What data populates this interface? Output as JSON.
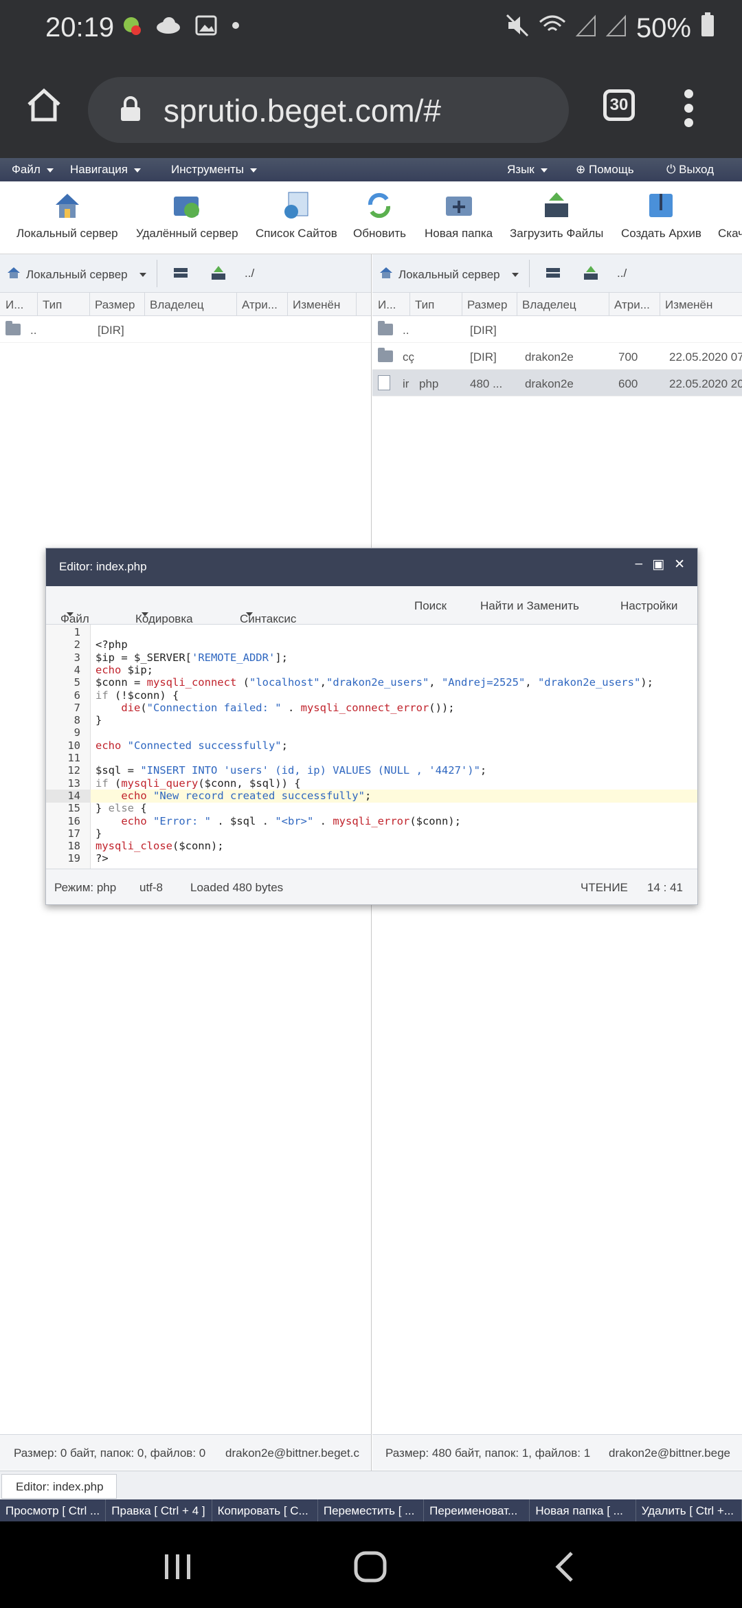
{
  "status_bar": {
    "time": "20:19",
    "battery": "50%"
  },
  "browser": {
    "url": "sprutio.beget.com/#",
    "tab_count": "30"
  },
  "menubar": {
    "left": [
      "Файл",
      "Навигация",
      "Инструменты"
    ],
    "language": "Язык",
    "help": "Помощь",
    "exit": "Выход"
  },
  "toolbar": {
    "items": [
      "Локальный сервер",
      "Удалённый сервер",
      "Список Сайтов",
      "Обновить",
      "Новая папка",
      "Загрузить Файлы",
      "Создать Архив",
      "Скач"
    ]
  },
  "left_panel": {
    "server": "Локальный сервер",
    "path": "../",
    "columns": [
      "И...",
      "Тип",
      "Размер",
      "Владелец",
      "Атри...",
      "Изменён"
    ],
    "rows": [
      {
        "name": "..",
        "type": "",
        "size": "[DIR]",
        "owner": "",
        "attr": "",
        "modified": ""
      }
    ],
    "status": "Размер: 0 байт, папок: 0, файлов: 0",
    "host": "drakon2e@bittner.beget.c"
  },
  "right_panel": {
    "server": "Локальный сервер",
    "path": "../",
    "columns": [
      "И...",
      "Тип",
      "Размер",
      "Владелец",
      "Атри...",
      "Изменён"
    ],
    "rows": [
      {
        "name": "..",
        "type": "",
        "size": "[DIR]",
        "owner": "",
        "attr": "",
        "modified": ""
      },
      {
        "name": "cç",
        "type": "",
        "size": "[DIR]",
        "owner": "drakon2e",
        "attr": "700",
        "modified": "22.05.2020 07"
      },
      {
        "name": "ir",
        "type": "php",
        "size": "480 ...",
        "owner": "drakon2e",
        "attr": "600",
        "modified": "22.05.2020 20"
      }
    ],
    "status": "Размер: 480 байт, папок: 1, файлов: 1",
    "host": "drakon2e@bittner.bege"
  },
  "editor": {
    "title": "Editor: index.php",
    "menu": [
      "Файл",
      "Кодировка",
      "Синтаксис"
    ],
    "search": "Поиск",
    "find_replace": "Найти и Заменить",
    "settings": "Настройки",
    "code_lines": [
      "",
      "<?php",
      "$ip = $_SERVER['REMOTE_ADDR'];",
      "echo $ip;",
      "$conn = mysqli_connect (\"localhost\",\"drakon2e_users\", \"Andrej=2525\", \"drakon2e_users\");",
      "if (!$conn) {",
      "    die(\"Connection failed: \" . mysqli_connect_error());",
      "}",
      "",
      "echo \"Connected successfully\";",
      "",
      "$sql = \"INSERT INTO 'users' (id, ip) VALUES (NULL , '4427')\";",
      "if (mysqli_query($conn, $sql)) {",
      "    echo \"New record created successfully\";",
      "} else {",
      "    echo \"Error: \" . $sql . \"<br>\" . mysqli_error($conn);",
      "}",
      "mysqli_close($conn);",
      "?>"
    ],
    "highlighted_line": 14,
    "mode": "Режим: php",
    "encoding": "utf-8",
    "loaded": "Loaded 480 bytes",
    "read_mode": "ЧТЕНИЕ",
    "cursor": "14 : 41"
  },
  "taskbar": {
    "tab": "Editor: index.php"
  },
  "fkeys": [
    "Просмотр [ Ctrl ...",
    "Правка [ Ctrl + 4 ]",
    "Копировать [ C...",
    "Переместить [ ...",
    "Переименоват...",
    "Новая папка [ ...",
    "Удалить [ Ctrl +..."
  ]
}
